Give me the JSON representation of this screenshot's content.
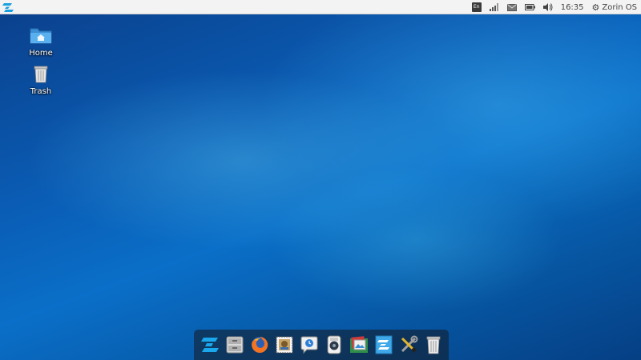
{
  "top_panel": {
    "keyboard_indicator": "En",
    "clock": "16:35",
    "session_label": "Zorin OS",
    "icons": [
      "zorin-menu-icon",
      "keyboard-layout-icon",
      "network-signal-icon",
      "mail-icon",
      "battery-icon",
      "volume-icon",
      "gear-icon"
    ]
  },
  "desktop": {
    "icons": [
      {
        "label": "Home",
        "icon": "home-folder-icon"
      },
      {
        "label": "Trash",
        "icon": "trash-icon"
      }
    ],
    "wallpaper_colors": [
      "#0b3f8a",
      "#0a6fc8",
      "#5fd4ff"
    ]
  },
  "dock": {
    "apps": [
      {
        "name": "zorin-menu",
        "icon": "zorin-logo-icon"
      },
      {
        "name": "files",
        "icon": "files-icon"
      },
      {
        "name": "firefox",
        "icon": "firefox-icon"
      },
      {
        "name": "mail",
        "icon": "mail-stamp-icon"
      },
      {
        "name": "chat",
        "icon": "chat-bubble-icon"
      },
      {
        "name": "music",
        "icon": "music-player-icon"
      },
      {
        "name": "photos",
        "icon": "photos-icon"
      },
      {
        "name": "documents",
        "icon": "document-icon"
      },
      {
        "name": "settings",
        "icon": "tools-icon"
      },
      {
        "name": "trash",
        "icon": "trash-can-icon"
      }
    ]
  }
}
